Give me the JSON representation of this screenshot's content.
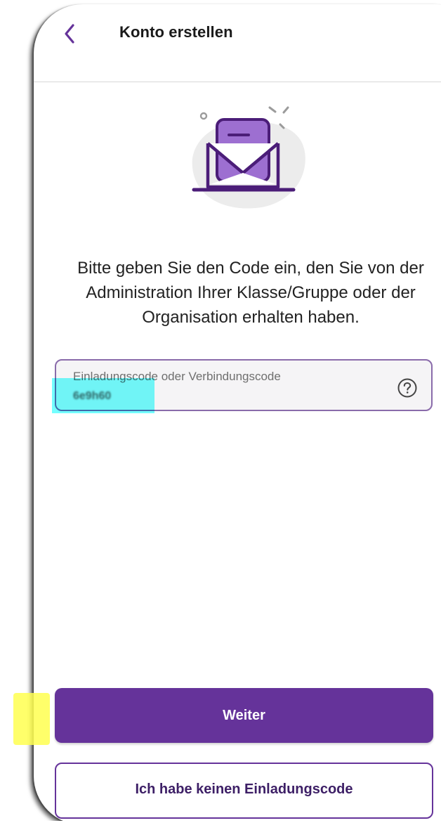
{
  "header": {
    "back_icon": "chevron-left-icon",
    "title": "Konto erstellen"
  },
  "illustration": {
    "icon": "envelope-letter-icon",
    "accent_color": "#6a3a9e",
    "fill_color": "#9d6fd1"
  },
  "main": {
    "instructions": "Bitte geben Sie den Code ein, den Sie von der Administration Ihrer Klasse/Gruppe oder der Organisation erhalten haben."
  },
  "code_field": {
    "label": "Einladungscode oder Verbindungscode",
    "value": "6e9h60",
    "help_icon": "question-circle-icon"
  },
  "actions": {
    "primary_label": "Weiter",
    "secondary_label": "Ich habe keinen Einladungscode"
  },
  "colors": {
    "brand": "#65339a",
    "field_border": "#8a6bab",
    "highlight_cyan": "#46ffff",
    "highlight_yellow": "#ffff50"
  }
}
